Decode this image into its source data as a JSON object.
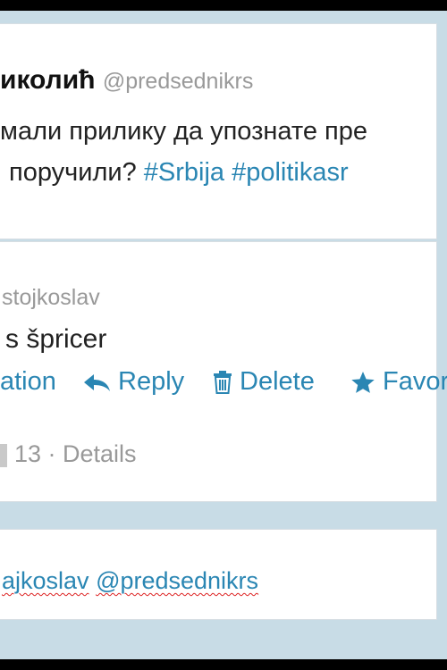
{
  "tweet": {
    "name": "иколић",
    "handle": "@predsednikrs",
    "line1": "мали прилику да упознате пре",
    "line2_text": "поручили? ",
    "hashtags": [
      "#Srbija",
      "#politikasr"
    ]
  },
  "reply": {
    "handle": "stojkoslav",
    "text": "s špricer",
    "actions": {
      "conversation": "ation",
      "reply": "Reply",
      "delete": "Delete",
      "favorite": "Favor"
    },
    "meta": "13 · Details"
  },
  "compose": {
    "mention1": "ajkoslav",
    "mention2": "@predsednikrs"
  },
  "icons": {
    "reply": "reply-arrow-icon",
    "delete": "trash-icon",
    "favorite": "star-icon"
  },
  "colors": {
    "link": "#2a86b3",
    "muted": "#999999",
    "background": "#c8dce6"
  }
}
